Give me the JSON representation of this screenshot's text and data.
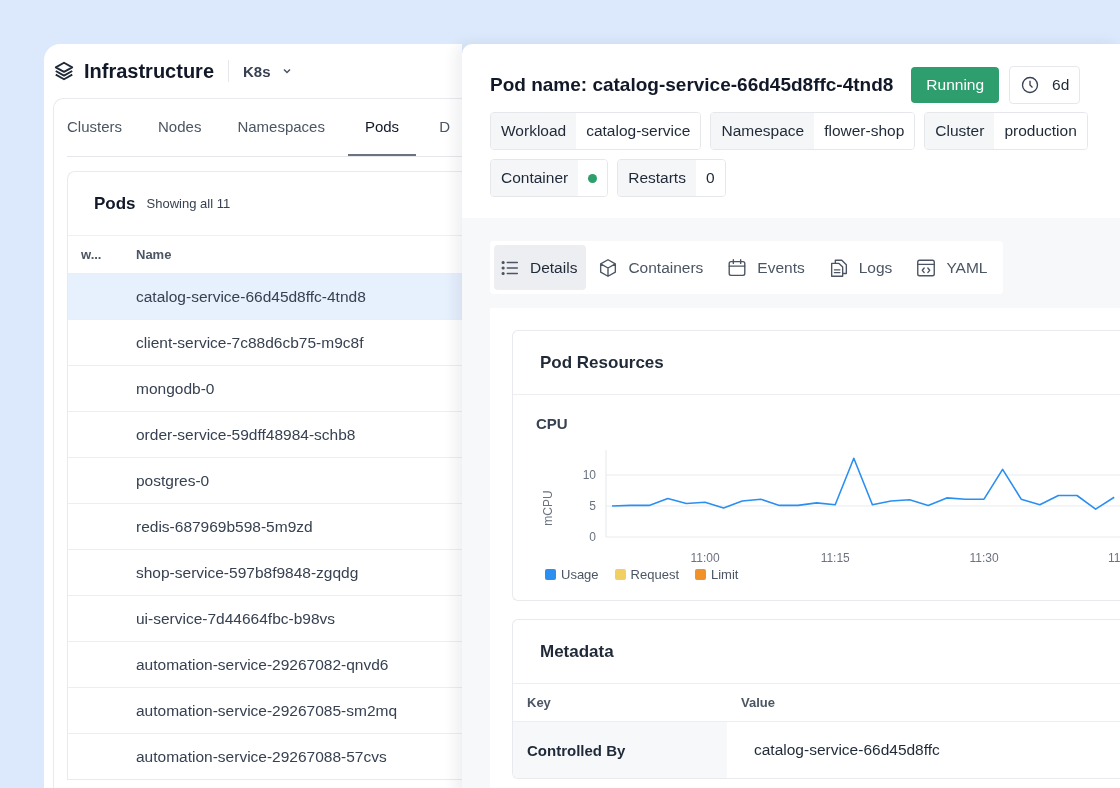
{
  "app": {
    "title": "Infrastructure",
    "context": "K8s"
  },
  "tabs": [
    {
      "label": "Clusters",
      "selected": false
    },
    {
      "label": "Nodes",
      "selected": false
    },
    {
      "label": "Namespaces",
      "selected": false
    },
    {
      "label": "Pods",
      "selected": true
    },
    {
      "label": "D",
      "selected": false
    }
  ],
  "pods_table": {
    "title": "Pods",
    "subtitle": "Showing all 11",
    "columns": [
      "w...",
      "Name"
    ],
    "rows": [
      {
        "name": "catalog-service-66d45d8ffc-4tnd8",
        "selected": true
      },
      {
        "name": "client-service-7c88d6cb75-m9c8f",
        "selected": false
      },
      {
        "name": "mongodb-0",
        "selected": false
      },
      {
        "name": "order-service-59dff48984-schb8",
        "selected": false
      },
      {
        "name": "postgres-0",
        "selected": false
      },
      {
        "name": "redis-687969b598-5m9zd",
        "selected": false
      },
      {
        "name": "shop-service-597b8f9848-zgqdg",
        "selected": false
      },
      {
        "name": "ui-service-7d44664fbc-b98vs",
        "selected": false
      },
      {
        "name": "automation-service-29267082-qnvd6",
        "selected": false
      },
      {
        "name": "automation-service-29267085-sm2mq",
        "selected": false
      },
      {
        "name": "automation-service-29267088-57cvs",
        "selected": false
      }
    ]
  },
  "pod": {
    "title": "Pod name: catalog-service-66d45d8ffc-4tnd8",
    "status": "Running",
    "age": "6d",
    "tags": [
      {
        "kind": "text",
        "label": "Workload",
        "value": "catalog-service"
      },
      {
        "kind": "text",
        "label": "Namespace",
        "value": "flower-shop"
      },
      {
        "kind": "text",
        "label": "Cluster",
        "value": "production"
      },
      {
        "kind": "dot",
        "label": "Container",
        "color": "#2e9e6b"
      },
      {
        "kind": "text",
        "label": "Restarts",
        "value": "0"
      }
    ]
  },
  "detail_tabs": [
    {
      "label": "Details",
      "selected": true
    },
    {
      "label": "Containers",
      "selected": false
    },
    {
      "label": "Events",
      "selected": false
    },
    {
      "label": "Logs",
      "selected": false
    },
    {
      "label": "YAML",
      "selected": false
    }
  ],
  "resources": {
    "title": "Pod Resources",
    "cpu": {
      "title": "CPU",
      "chart_data": {
        "type": "line",
        "ylabel": "mCPU",
        "ylim": [
          0,
          14
        ],
        "yticks": [
          0,
          5,
          10
        ],
        "categories": [
          null,
          null,
          null,
          null,
          null,
          "11:00",
          null,
          null,
          null,
          null,
          null,
          null,
          "11:15",
          null,
          null,
          null,
          null,
          null,
          null,
          null,
          "11:30",
          null,
          null,
          null,
          null,
          null,
          null,
          "11"
        ],
        "series": [
          {
            "name": "Usage",
            "color": "#2b8ff2",
            "values": [
              5.0,
              5.1,
              5.1,
              6.2,
              5.4,
              5.6,
              4.7,
              5.8,
              6.1,
              5.1,
              5.1,
              5.5,
              5.2,
              12.7,
              5.2,
              5.8,
              6.0,
              5.1,
              6.3,
              6.1,
              6.1,
              10.9,
              6.1,
              5.2,
              6.7,
              6.7,
              4.5,
              6.4
            ]
          }
        ]
      },
      "legend": [
        {
          "label": "Request",
          "color": "#f2cf63"
        },
        {
          "label": "Limit",
          "color": "#f0912a"
        }
      ]
    }
  },
  "metadata": {
    "title": "Metadata",
    "columns": [
      "Key",
      "Value"
    ],
    "rows": [
      {
        "key": "Controlled By",
        "value": "catalog-service-66d45d8ffc"
      }
    ]
  }
}
